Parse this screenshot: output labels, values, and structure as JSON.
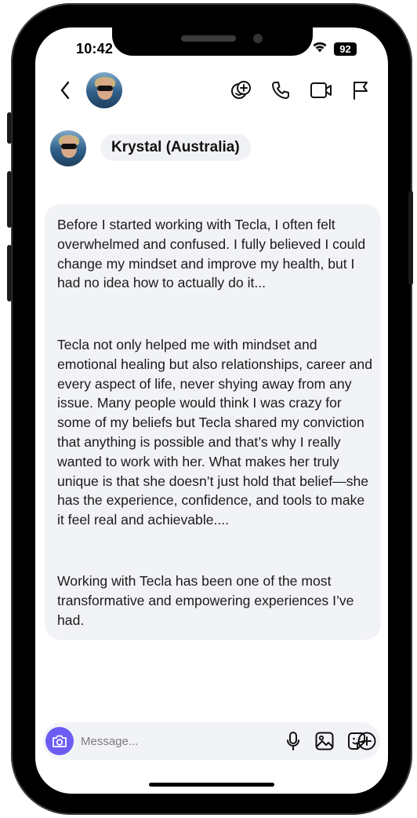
{
  "status_bar": {
    "time": "10:42",
    "battery": "92"
  },
  "chat": {
    "contact_name": "Krystal (Australia)"
  },
  "message": {
    "paragraphs": [
      "Before I started working with Tecla, I often felt overwhelmed and confused. I fully believed I could change my mindset and improve my health, but I had no idea how to actually do it...",
      "Tecla not only helped me with mindset and emotional healing but also relationships, career and every aspect of life, never shying away from any issue. Many people would think I was crazy for some of my beliefs but Tecla shared my conviction that anything is possible and that’s why I really wanted to work with her. What makes her truly unique is that she doesn’t just hold that belief—she has the experience, confidence, and tools to make it feel real and achievable....",
      "Working with Tecla has been one of the most transformative and empowering experiences I’ve had."
    ]
  },
  "composer": {
    "placeholder": "Message..."
  },
  "icons": {
    "nav": [
      "back-icon",
      "emoji-add-icon",
      "phone-icon",
      "video-call-icon",
      "flag-icon"
    ],
    "composer": [
      "camera-icon",
      "microphone-icon",
      "gallery-icon",
      "sticker-icon",
      "add-icon"
    ],
    "status": [
      "wifi-icon",
      "battery-icon"
    ]
  },
  "colors": {
    "accent": "#6d5cf4",
    "bubble_bg": "#f2f3f6",
    "frame": "#000000"
  }
}
